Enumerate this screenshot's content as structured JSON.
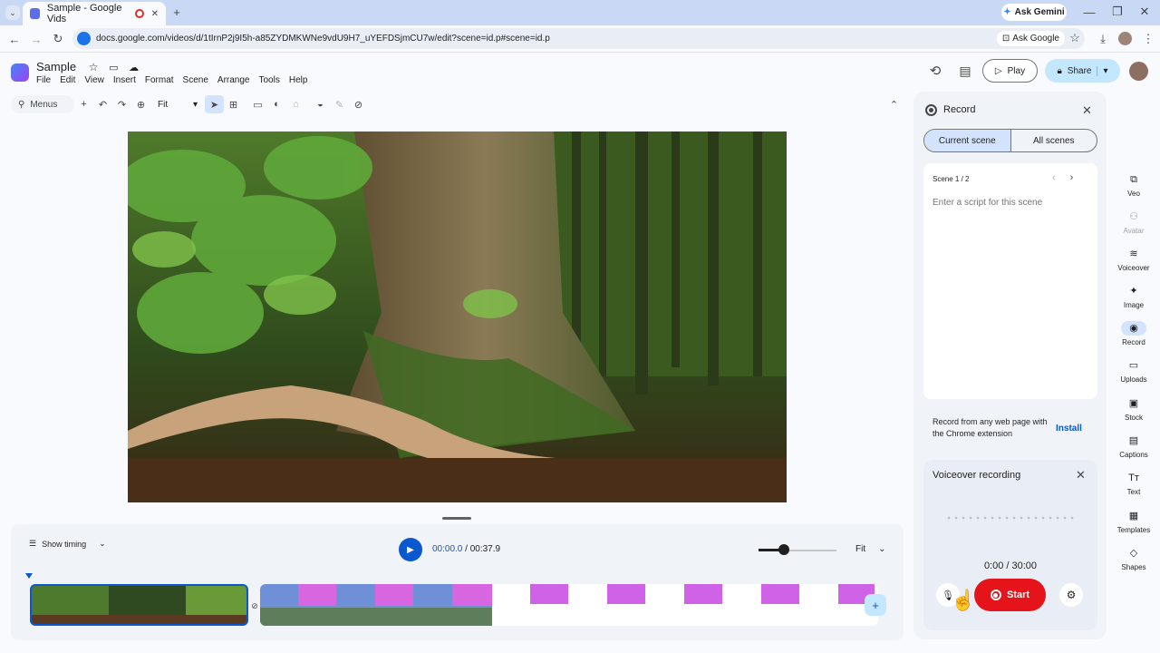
{
  "browser": {
    "tab_title": "Sample - Google Vids",
    "ask_gemini": "Ask Gemini",
    "url": "docs.google.com/videos/d/1tIrnP2j9I5h-a85ZYDMKWNe9vdU9H7_uYEFDSjmCU7w/edit?scene=id.p#scene=id.p",
    "ask_google": "Ask Google"
  },
  "app": {
    "title": "Sample",
    "menus": [
      "File",
      "Edit",
      "View",
      "Insert",
      "Format",
      "Scene",
      "Arrange",
      "Tools",
      "Help"
    ],
    "play_label": "Play",
    "share_label": "Share"
  },
  "edit_toolbar": {
    "menus_placeholder": "Menus",
    "zoom_label": "Fit"
  },
  "timeline": {
    "show_timing": "Show timing",
    "current_time": "00:00.0",
    "separator": "/",
    "total_time": "00:37.9",
    "zoom_level": 0.33,
    "fit_label": "Fit"
  },
  "record_panel": {
    "title": "Record",
    "tabs": [
      "Current scene",
      "All scenes"
    ],
    "scene_label": "Scene 1 / 2",
    "script_placeholder": "Enter a script for this scene",
    "extension_text": "Record from any web page with the Chrome extension",
    "install_label": "Install",
    "voiceover": {
      "title": "Voiceover recording",
      "time": "0:00 / 30:00",
      "start_label": "Start"
    }
  },
  "rail": [
    {
      "label": "Veo",
      "icon": "veo-icon",
      "glyph": "⧉"
    },
    {
      "label": "Avatar",
      "icon": "avatar-icon",
      "glyph": "⚇"
    },
    {
      "label": "Voiceover",
      "icon": "voiceover-icon",
      "glyph": "≋"
    },
    {
      "label": "Image",
      "icon": "image-icon",
      "glyph": "✦"
    },
    {
      "label": "Record",
      "icon": "record-icon",
      "glyph": "◉"
    },
    {
      "label": "Uploads",
      "icon": "folder-icon",
      "glyph": "▭"
    },
    {
      "label": "Stock",
      "icon": "stock-icon",
      "glyph": "▣"
    },
    {
      "label": "Captions",
      "icon": "captions-icon",
      "glyph": "▤"
    },
    {
      "label": "Text",
      "icon": "text-icon",
      "glyph": "Tт"
    },
    {
      "label": "Templates",
      "icon": "templates-icon",
      "glyph": "▦"
    },
    {
      "label": "Shapes",
      "icon": "shapes-icon",
      "glyph": "◇"
    }
  ],
  "colors": {
    "accent": "#0b57d0",
    "record_red": "#e5131a",
    "share_bg": "#c2e7ff"
  }
}
